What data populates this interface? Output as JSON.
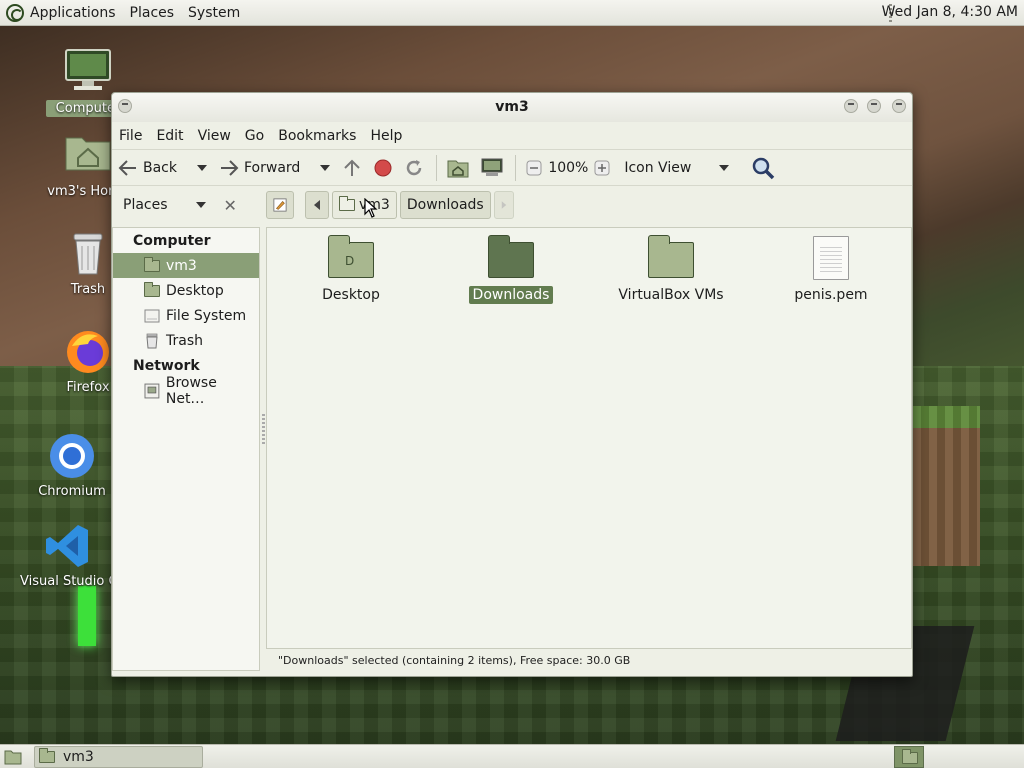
{
  "top_panel": {
    "menus": [
      "Applications",
      "Places",
      "System"
    ],
    "clock": "Wed Jan  8,  4:30 AM"
  },
  "desktop": {
    "icons": [
      {
        "label": "Computer",
        "icon": "computer-icon"
      },
      {
        "label": "vm3's Home",
        "icon": "home-folder-icon"
      },
      {
        "label": "Trash",
        "icon": "trash-icon"
      },
      {
        "label": "Firefox",
        "icon": "firefox-icon"
      },
      {
        "label": "Chromium",
        "icon": "chromium-icon"
      },
      {
        "label": "Visual Studio Code",
        "icon": "vscode-icon"
      }
    ]
  },
  "window": {
    "title": "vm3",
    "menu": [
      "File",
      "Edit",
      "View",
      "Go",
      "Bookmarks",
      "Help"
    ],
    "toolbar": {
      "back_label": "Back",
      "forward_label": "Forward",
      "zoom": "100%",
      "view_mode": "Icon View"
    },
    "location": {
      "places_label": "Places",
      "crumbs": [
        "vm3",
        "Downloads"
      ]
    },
    "sidebar": {
      "sections": [
        {
          "title": "Computer",
          "items": [
            {
              "label": "vm3",
              "selected": true
            },
            {
              "label": "Desktop"
            },
            {
              "label": "File System"
            },
            {
              "label": "Trash"
            }
          ]
        },
        {
          "title": "Network",
          "items": [
            {
              "label": "Browse Net…"
            }
          ]
        }
      ]
    },
    "files": [
      {
        "name": "Desktop",
        "type": "folder"
      },
      {
        "name": "Downloads",
        "type": "folder",
        "selected": true
      },
      {
        "name": "VirtualBox VMs",
        "type": "folder"
      },
      {
        "name": "penis.pem",
        "type": "file"
      }
    ],
    "status": "\"Downloads\" selected (containing 2 items), Free space: 30.0 GB"
  },
  "bottom_panel": {
    "task_label": "vm3"
  },
  "colors": {
    "accent": "#8a9f77",
    "selection_dark": "#627c4f",
    "folder": "#a8b78f",
    "folder_dark": "#5f7550"
  }
}
